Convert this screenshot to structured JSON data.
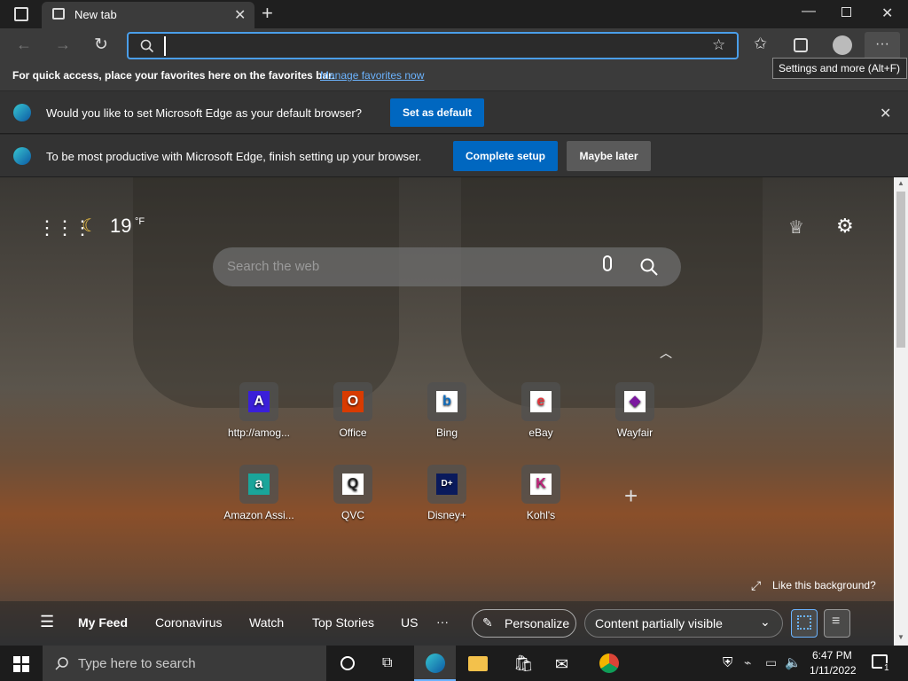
{
  "browser": {
    "tab_title": "New tab",
    "address_value": "",
    "favorites_hint": "For quick access, place your favorites here on the favorites bar.",
    "manage_favorites": "Manage favorites now",
    "tooltip": "Settings and more (Alt+F)"
  },
  "infobar_default": {
    "message": "Would you like to set Microsoft Edge as your default browser?",
    "button": "Set as default"
  },
  "infobar_setup": {
    "message": "To be most productive with Microsoft Edge, finish setting up your browser.",
    "primary": "Complete setup",
    "secondary": "Maybe later"
  },
  "newtab": {
    "temperature": "19",
    "unit": "°F",
    "search_placeholder": "Search the web",
    "like_background": "Like this background?"
  },
  "tiles": [
    {
      "label": "http://amog...",
      "icon": "A",
      "color": "#3a1fd9",
      "fg": "#ffffff"
    },
    {
      "label": "Office",
      "icon": "O",
      "color": "#d83b01",
      "fg": "#ffffff"
    },
    {
      "label": "Bing",
      "icon": "b",
      "color": "#ffffff",
      "fg": "#0f6cbd"
    },
    {
      "label": "eBay",
      "icon": "e",
      "color": "#ffffff",
      "fg": "#e53238"
    },
    {
      "label": "Wayfair",
      "icon": "◆",
      "color": "#ffffff",
      "fg": "#7b189f"
    },
    {
      "label": "Amazon Assi...",
      "icon": "a",
      "color": "#1aa59a",
      "fg": "#ffffff"
    },
    {
      "label": "QVC",
      "icon": "Q",
      "color": "#ffffff",
      "fg": "#222222"
    },
    {
      "label": "Disney+",
      "icon": "D+",
      "color": "#0a1a5c",
      "fg": "#ffffff"
    },
    {
      "label": "Kohl's",
      "icon": "K",
      "color": "#ffffff",
      "fg": "#c0237a"
    }
  ],
  "feed": {
    "my_feed": "My Feed",
    "items": [
      "Coronavirus",
      "Watch",
      "Top Stories",
      "US"
    ],
    "more": "···",
    "personalize": "Personalize",
    "content_visibility": "Content partially visible"
  },
  "taskbar": {
    "search_placeholder": "Type here to search",
    "time": "6:47 PM",
    "date": "1/11/2022",
    "notifications": "1"
  }
}
